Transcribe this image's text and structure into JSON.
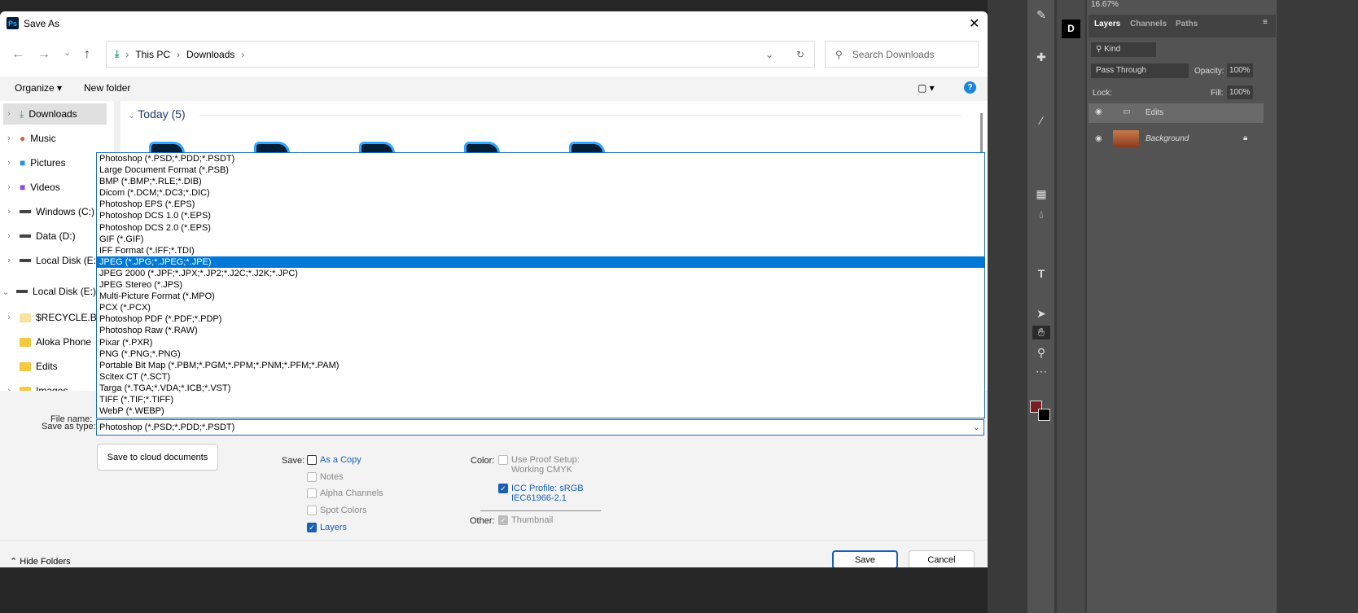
{
  "dialog": {
    "title": "Save As",
    "app_icon": "Ps",
    "close": "✕"
  },
  "nav": {
    "back": "←",
    "forward": "→",
    "recent": "⌄",
    "up": "↑",
    "breadcrumb": [
      "This PC",
      "Downloads"
    ],
    "search_placeholder": "Search Downloads"
  },
  "toolbar": {
    "organize": "Organize ▾",
    "new_folder": "New folder",
    "help": "?"
  },
  "sidebar": {
    "items": [
      {
        "label": "Downloads",
        "icon": "download-icon"
      },
      {
        "label": "Music",
        "icon": "music-icon"
      },
      {
        "label": "Pictures",
        "icon": "pictures-icon"
      },
      {
        "label": "Videos",
        "icon": "videos-icon"
      },
      {
        "label": "Windows (C:)",
        "icon": "drive-icon"
      },
      {
        "label": "Data (D:)",
        "icon": "drive-icon"
      },
      {
        "label": "Local Disk (E:)",
        "icon": "drive-icon"
      },
      {
        "label": "Local Disk (E:)",
        "icon": "drive-icon"
      },
      {
        "label": "$RECYCLE.BIN",
        "icon": "folder-icon"
      },
      {
        "label": "Aloka Phone",
        "icon": "folder-icon"
      },
      {
        "label": "Edits",
        "icon": "folder-icon"
      },
      {
        "label": "Images",
        "icon": "folder-icon"
      }
    ]
  },
  "content": {
    "group": "Today (5)"
  },
  "file_types": [
    "Photoshop (*.PSD;*.PDD;*.PSDT)",
    "Large Document Format (*.PSB)",
    "BMP (*.BMP;*.RLE;*.DIB)",
    "Dicom (*.DCM;*.DC3;*.DIC)",
    "Photoshop EPS (*.EPS)",
    "Photoshop DCS 1.0 (*.EPS)",
    "Photoshop DCS 2.0 (*.EPS)",
    "GIF (*.GIF)",
    "IFF Format (*.IFF;*.TDI)",
    "JPEG (*.JPG;*.JPEG;*.JPE)",
    "JPEG 2000 (*.JPF;*.JPX;*.JP2;*.J2C;*.J2K;*.JPC)",
    "JPEG Stereo (*.JPS)",
    "Multi-Picture Format (*.MPO)",
    "PCX (*.PCX)",
    "Photoshop PDF (*.PDF;*.PDP)",
    "Photoshop Raw (*.RAW)",
    "Pixar (*.PXR)",
    "PNG (*.PNG;*.PNG)",
    "Portable Bit Map (*.PBM;*.PGM;*.PPM;*.PNM;*.PFM;*.PAM)",
    "Scitex CT (*.SCT)",
    "Targa (*.TGA;*.VDA;*.ICB;*.VST)",
    "TIFF (*.TIF;*.TIFF)",
    "WebP (*.WEBP)"
  ],
  "highlighted_type": "JPEG (*.JPG;*.JPEG;*.JPE)",
  "form": {
    "file_name_label": "File name:",
    "save_as_type_label": "Save as type:",
    "save_as_type_value": "Photoshop (*.PSD;*.PDD;*.PSDT)",
    "cloud": "Save to cloud documents"
  },
  "options": {
    "save_label": "Save:",
    "as_copy": "As a Copy",
    "notes": "Notes",
    "alpha": "Alpha Channels",
    "spot": "Spot Colors",
    "layers": "Layers",
    "color_label": "Color:",
    "proof": "Use Proof Setup:",
    "proof2": "Working CMYK",
    "icc": "ICC Profile:  sRGB",
    "icc2": "IEC61966-2.1",
    "other_label": "Other:",
    "thumbnail": "Thumbnail"
  },
  "footer": {
    "hide_folders": "Hide Folders",
    "save": "Save",
    "cancel": "Cancel"
  },
  "photoshop": {
    "zoom": "16.67%",
    "tabs": [
      "Layers",
      "Channels",
      "Paths"
    ],
    "kind": "Kind",
    "blend": "Pass Through",
    "opacity_label": "Opacity:",
    "opacity": "100%",
    "lock_label": "Lock:",
    "fill_label": "Fill:",
    "fill": "100%",
    "layers": [
      "Edits",
      "Background"
    ]
  }
}
